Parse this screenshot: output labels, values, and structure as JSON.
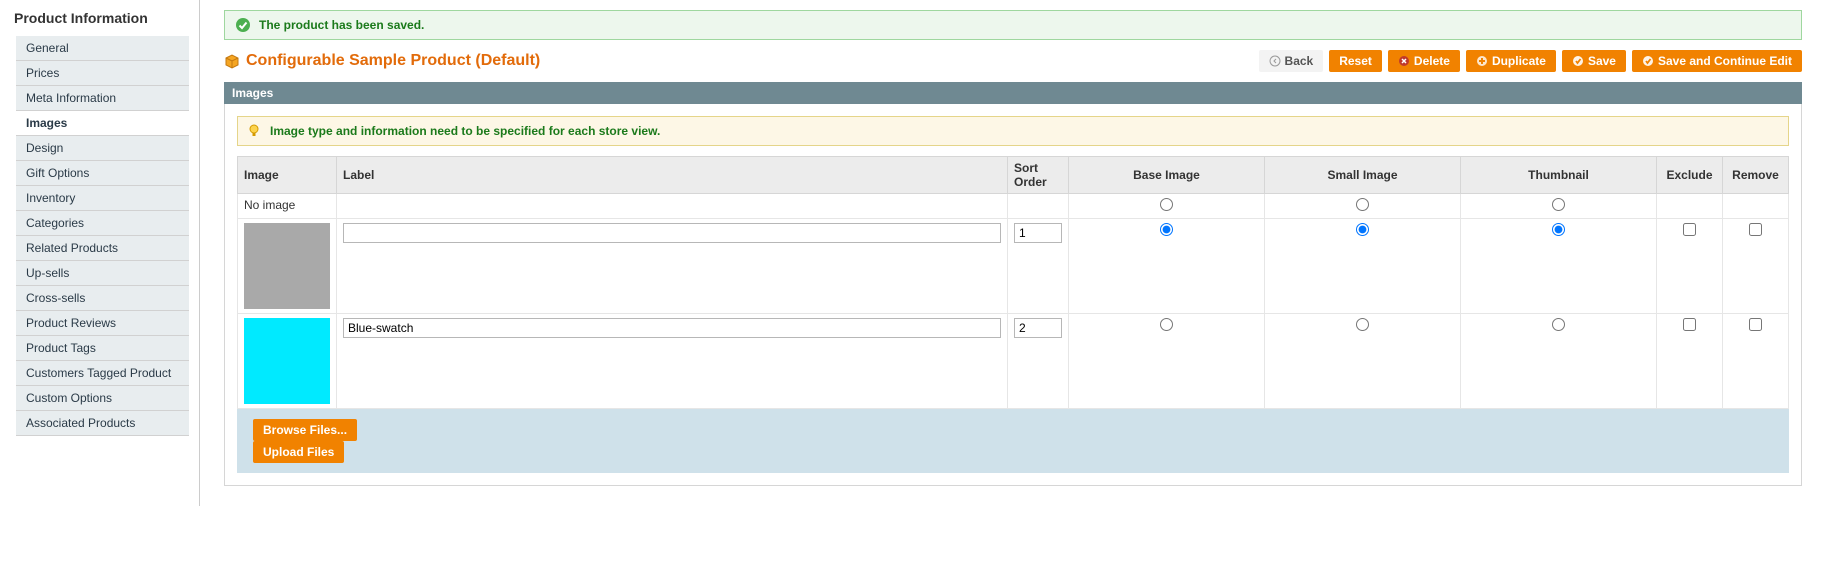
{
  "sidebar": {
    "title": "Product Information",
    "items": [
      {
        "label": "General"
      },
      {
        "label": "Prices"
      },
      {
        "label": "Meta Information"
      },
      {
        "label": "Images",
        "active": true
      },
      {
        "label": "Design"
      },
      {
        "label": "Gift Options"
      },
      {
        "label": "Inventory"
      },
      {
        "label": "Categories"
      },
      {
        "label": "Related Products"
      },
      {
        "label": "Up-sells"
      },
      {
        "label": "Cross-sells"
      },
      {
        "label": "Product Reviews"
      },
      {
        "label": "Product Tags"
      },
      {
        "label": "Customers Tagged Product"
      },
      {
        "label": "Custom Options"
      },
      {
        "label": "Associated Products"
      }
    ]
  },
  "success_message": "The product has been saved.",
  "page_title": "Configurable Sample Product (Default)",
  "buttons": {
    "back": "Back",
    "reset": "Reset",
    "delete": "Delete",
    "duplicate": "Duplicate",
    "save": "Save",
    "save_continue": "Save and Continue Edit"
  },
  "section_title": "Images",
  "tip_text": "Image type and information need to be specified for each store view.",
  "table": {
    "headers": {
      "image": "Image",
      "label": "Label",
      "sort_order": "Sort Order",
      "base_image": "Base Image",
      "small_image": "Small Image",
      "thumbnail": "Thumbnail",
      "exclude": "Exclude",
      "remove": "Remove"
    },
    "no_image_text": "No image",
    "rows": [
      {
        "swatch": "gray",
        "label": "",
        "sort_order": "1",
        "base": true,
        "small": true,
        "thumb": true,
        "exclude": false,
        "remove": false
      },
      {
        "swatch": "cyan",
        "label": "Blue-swatch",
        "sort_order": "2",
        "base": false,
        "small": false,
        "thumb": false,
        "exclude": false,
        "remove": false
      }
    ]
  },
  "upload": {
    "browse": "Browse Files...",
    "upload": "Upload Files"
  }
}
